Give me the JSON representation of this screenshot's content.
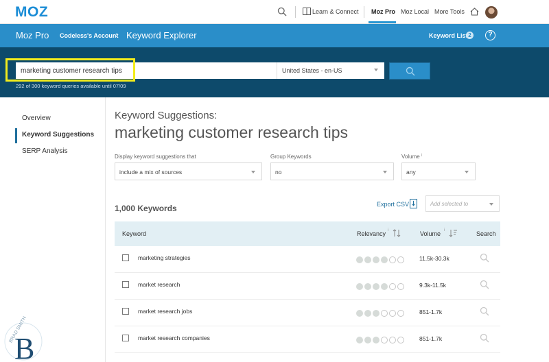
{
  "topnav": {
    "logo": "MOZ",
    "learn_connect": "Learn & Connect",
    "moz_pro": "Moz Pro",
    "moz_local": "Moz Local",
    "more_tools": "More Tools"
  },
  "header": {
    "app": "Moz Pro",
    "account": "Codeless's Account",
    "page": "Keyword Explorer",
    "keyword_lists": "Keyword Lists",
    "keyword_lists_count": "2",
    "help": "?"
  },
  "search": {
    "query": "marketing customer research tips",
    "locale": "United States - en-US",
    "quota": "292 of 300 keyword queries available until 07/09"
  },
  "sidebar": {
    "items": [
      {
        "label": "Overview"
      },
      {
        "label": "Keyword Suggestions"
      },
      {
        "label": "SERP Analysis"
      }
    ]
  },
  "main": {
    "subtitle": "Keyword Suggestions:",
    "title": "marketing customer research tips",
    "filters": {
      "display_label": "Display keyword suggestions that",
      "display_value": "include a mix of sources",
      "group_label": "Group Keywords",
      "group_value": "no",
      "volume_label": "Volume",
      "volume_value": "any"
    },
    "count": "1,000 Keywords",
    "export": "Export CSV",
    "add_selected_placeholder": "Add selected to",
    "table": {
      "headers": {
        "keyword": "Keyword",
        "relevancy": "Relevancy",
        "volume": "Volume",
        "search": "Search"
      },
      "rows": [
        {
          "keyword": "marketing strategies",
          "relevancy": 4,
          "volume": "11.5k-30.3k"
        },
        {
          "keyword": "market research",
          "relevancy": 4,
          "volume": "9.3k-11.5k"
        },
        {
          "keyword": "market research jobs",
          "relevancy": 3,
          "volume": "851-1.7k"
        },
        {
          "keyword": "market research companies",
          "relevancy": 3,
          "volume": "851-1.7k"
        }
      ]
    }
  },
  "watermark": {
    "text": "BRAD SMITH",
    "letter": "B"
  },
  "colors": {
    "brand_blue": "#2a8ec9",
    "dark_band": "#0d4a6b",
    "highlight": "#f2ec1c",
    "table_header": "#e2eff4"
  }
}
